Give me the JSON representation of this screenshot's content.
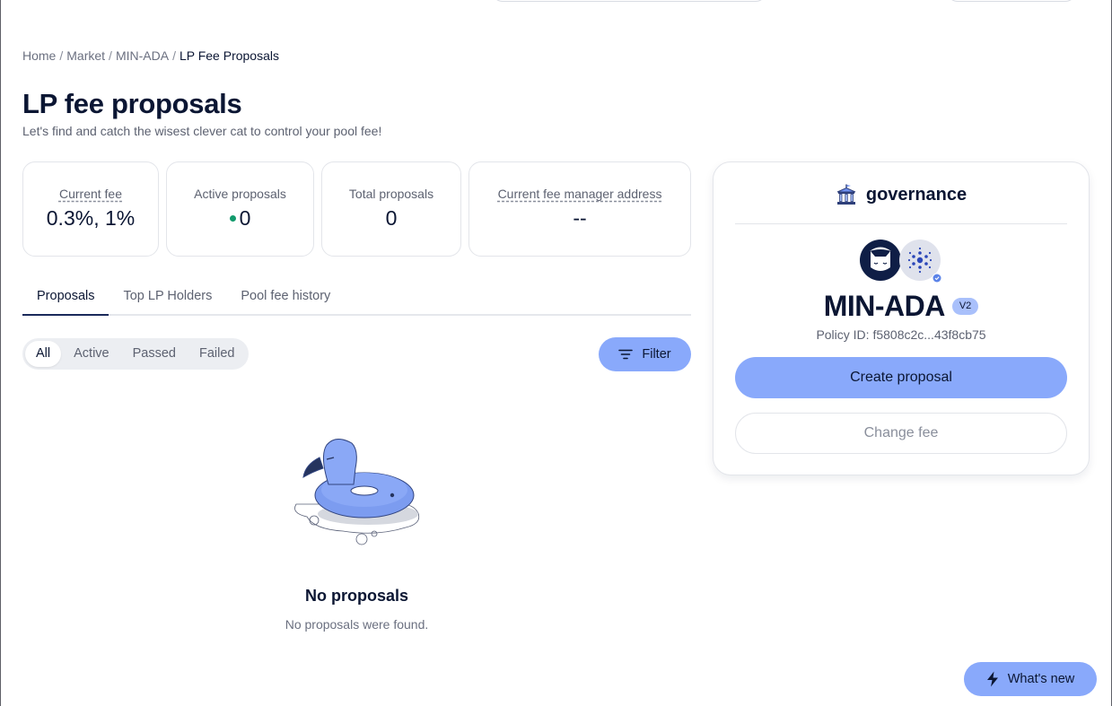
{
  "breadcrumb": {
    "items": [
      "Home",
      "Market",
      "MIN-ADA"
    ],
    "separator": "/",
    "current": "LP Fee Proposals"
  },
  "page": {
    "title": "LP fee proposals",
    "subtitle": "Let's find and catch the wisest clever cat to control your pool fee!"
  },
  "stats": {
    "current_fee": {
      "label": "Current fee",
      "value": "0.3%, 1%"
    },
    "active_proposals": {
      "label": "Active proposals",
      "value": "0"
    },
    "total_proposals": {
      "label": "Total proposals",
      "value": "0"
    },
    "fee_manager": {
      "label": "Current fee manager address",
      "value": "--"
    }
  },
  "tabs": [
    "Proposals",
    "Top LP Holders",
    "Pool fee history"
  ],
  "status_filter": [
    "All",
    "Active",
    "Passed",
    "Failed"
  ],
  "filter_button": "Filter",
  "empty_state": {
    "title": "No proposals",
    "subtitle": "No proposals were found."
  },
  "governance": {
    "title": "governance",
    "pair": "MIN-ADA",
    "version": "V2",
    "policy_id": "Policy ID: f5808c2c...43f8cb75",
    "create_button": "Create proposal",
    "change_button": "Change fee"
  },
  "whats_new": "What's new",
  "colors": {
    "accent": "#89a9fb",
    "text": "#0b1633",
    "active_dot": "#129a6c"
  },
  "icons": [
    "bank-icon",
    "filter-icon",
    "lightning-icon",
    "min-token-icon",
    "ada-token-icon",
    "verified-icon"
  ]
}
